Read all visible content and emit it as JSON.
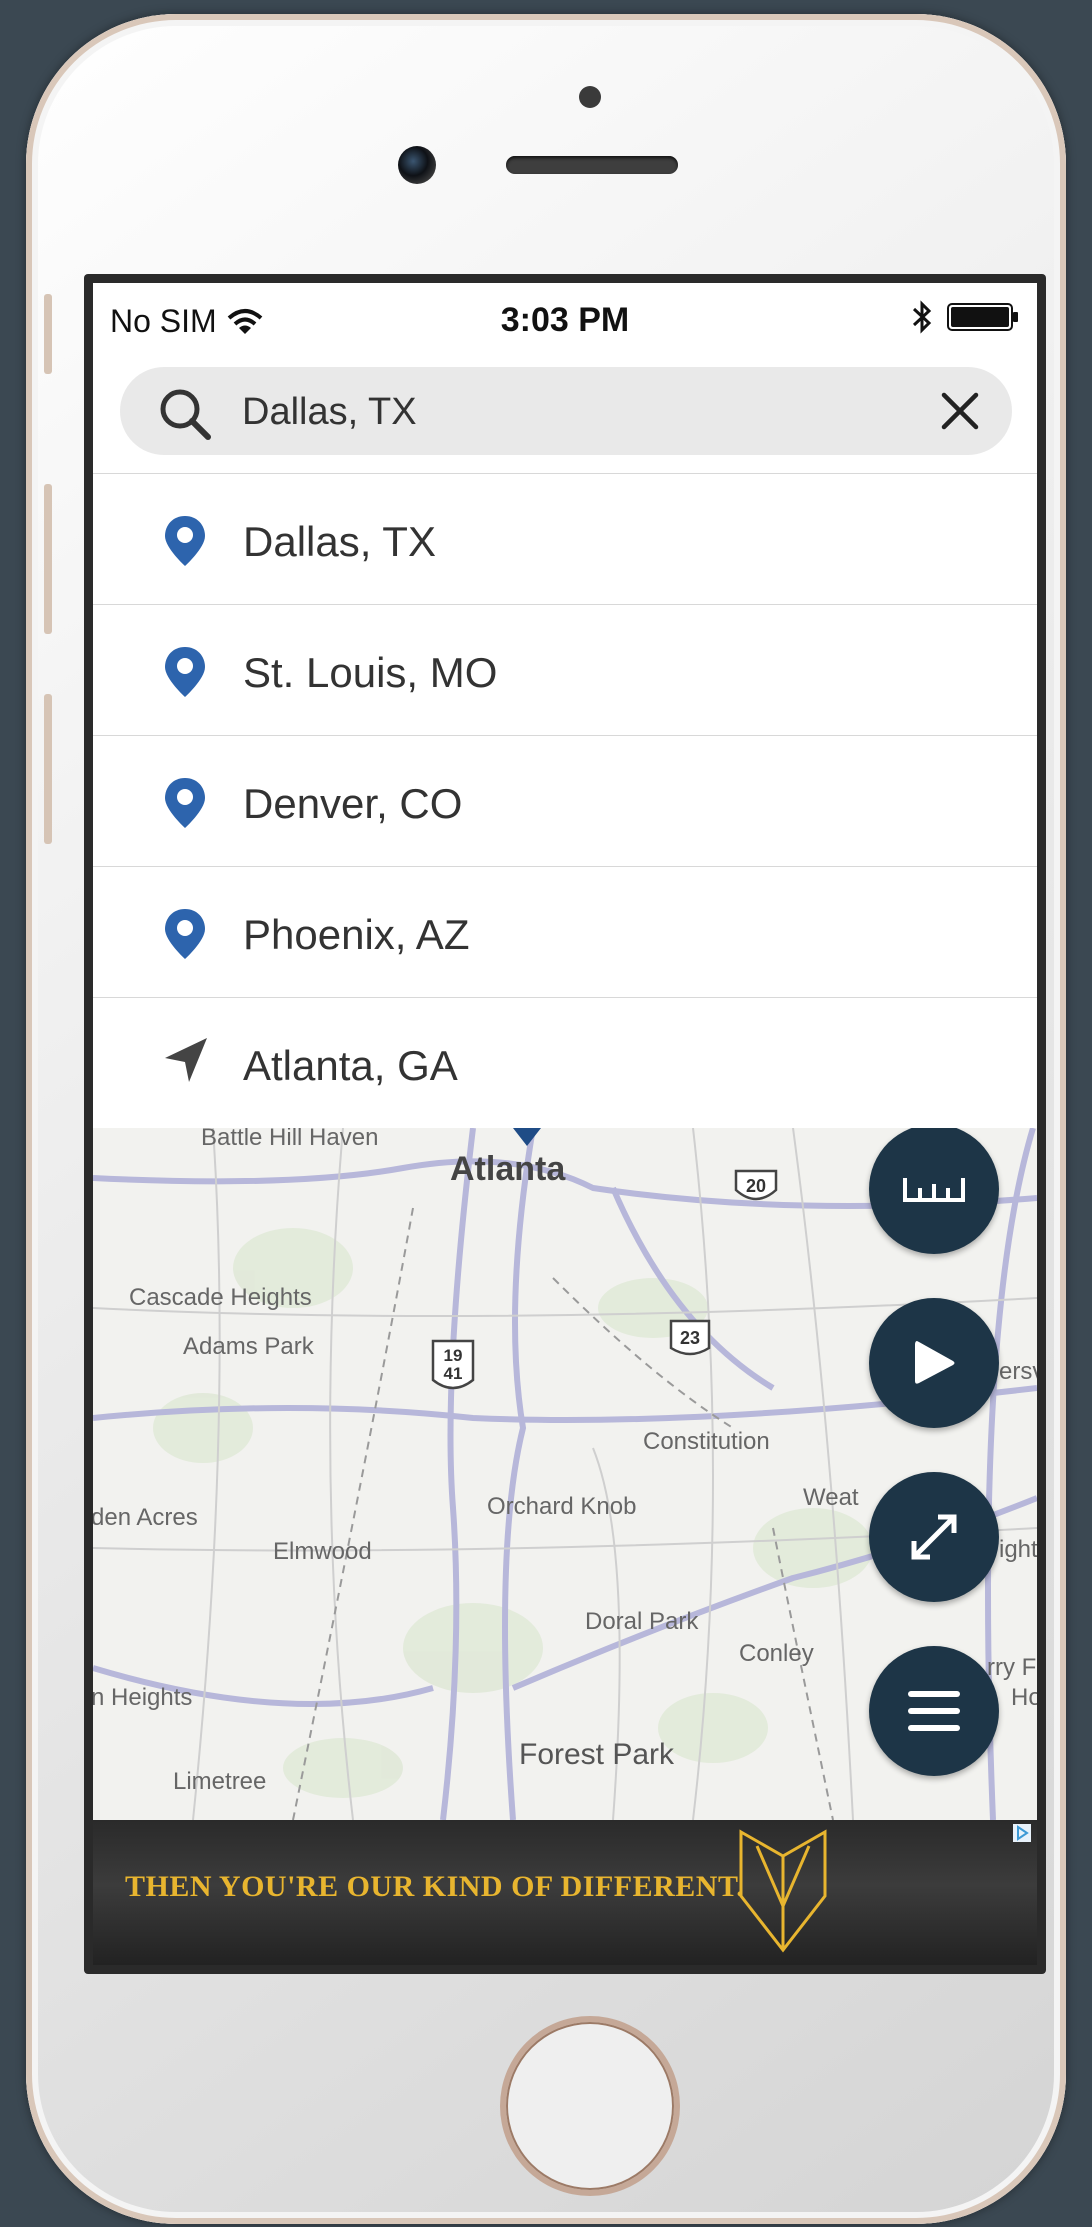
{
  "status": {
    "carrier": "No SIM",
    "time": "3:03 PM"
  },
  "search": {
    "value": "Dallas, TX"
  },
  "results": [
    {
      "label": "Dallas, TX",
      "icon": "location-pin-icon"
    },
    {
      "label": "St. Louis, MO",
      "icon": "location-pin-icon"
    },
    {
      "label": "Denver, CO",
      "icon": "location-pin-icon"
    },
    {
      "label": "Phoenix, AZ",
      "icon": "location-pin-icon"
    },
    {
      "label": "Atlanta, GA",
      "icon": "current-location-arrow-icon"
    }
  ],
  "map": {
    "labels": {
      "battle_hill": "Battle Hill Haven",
      "atlanta": "Atlanta",
      "cascade": "Cascade Heights",
      "adams": "Adams Park",
      "constitution": "Constitution",
      "orchard": "Orchard Knob",
      "den_acres": "den Acres",
      "elmwood": "Elmwood",
      "weat": "Weat",
      "doral": "Doral Park",
      "conley": "Conley",
      "heights": "n Heights",
      "forest_park": "Forest Park",
      "limetree": "Limetree",
      "ersv": "ersv",
      "ight": "ight",
      "rry": "rry F",
      "ho": "Ho"
    },
    "shields": {
      "i20": "20",
      "us23": "23",
      "us19": "19",
      "us41": "41"
    }
  },
  "fabs": [
    {
      "name": "measure-button",
      "icon": "ruler-icon"
    },
    {
      "name": "play-button",
      "icon": "play-icon"
    },
    {
      "name": "expand-button",
      "icon": "expand-icon"
    },
    {
      "name": "menu-button",
      "icon": "hamburger-menu-icon"
    }
  ],
  "ad": {
    "text": "THEN YOU'RE OUR KIND OF DIFFERENT."
  },
  "colors": {
    "pin": "#2d64ad",
    "fab": "#1d3547",
    "ad_text": "#e8b52f"
  }
}
